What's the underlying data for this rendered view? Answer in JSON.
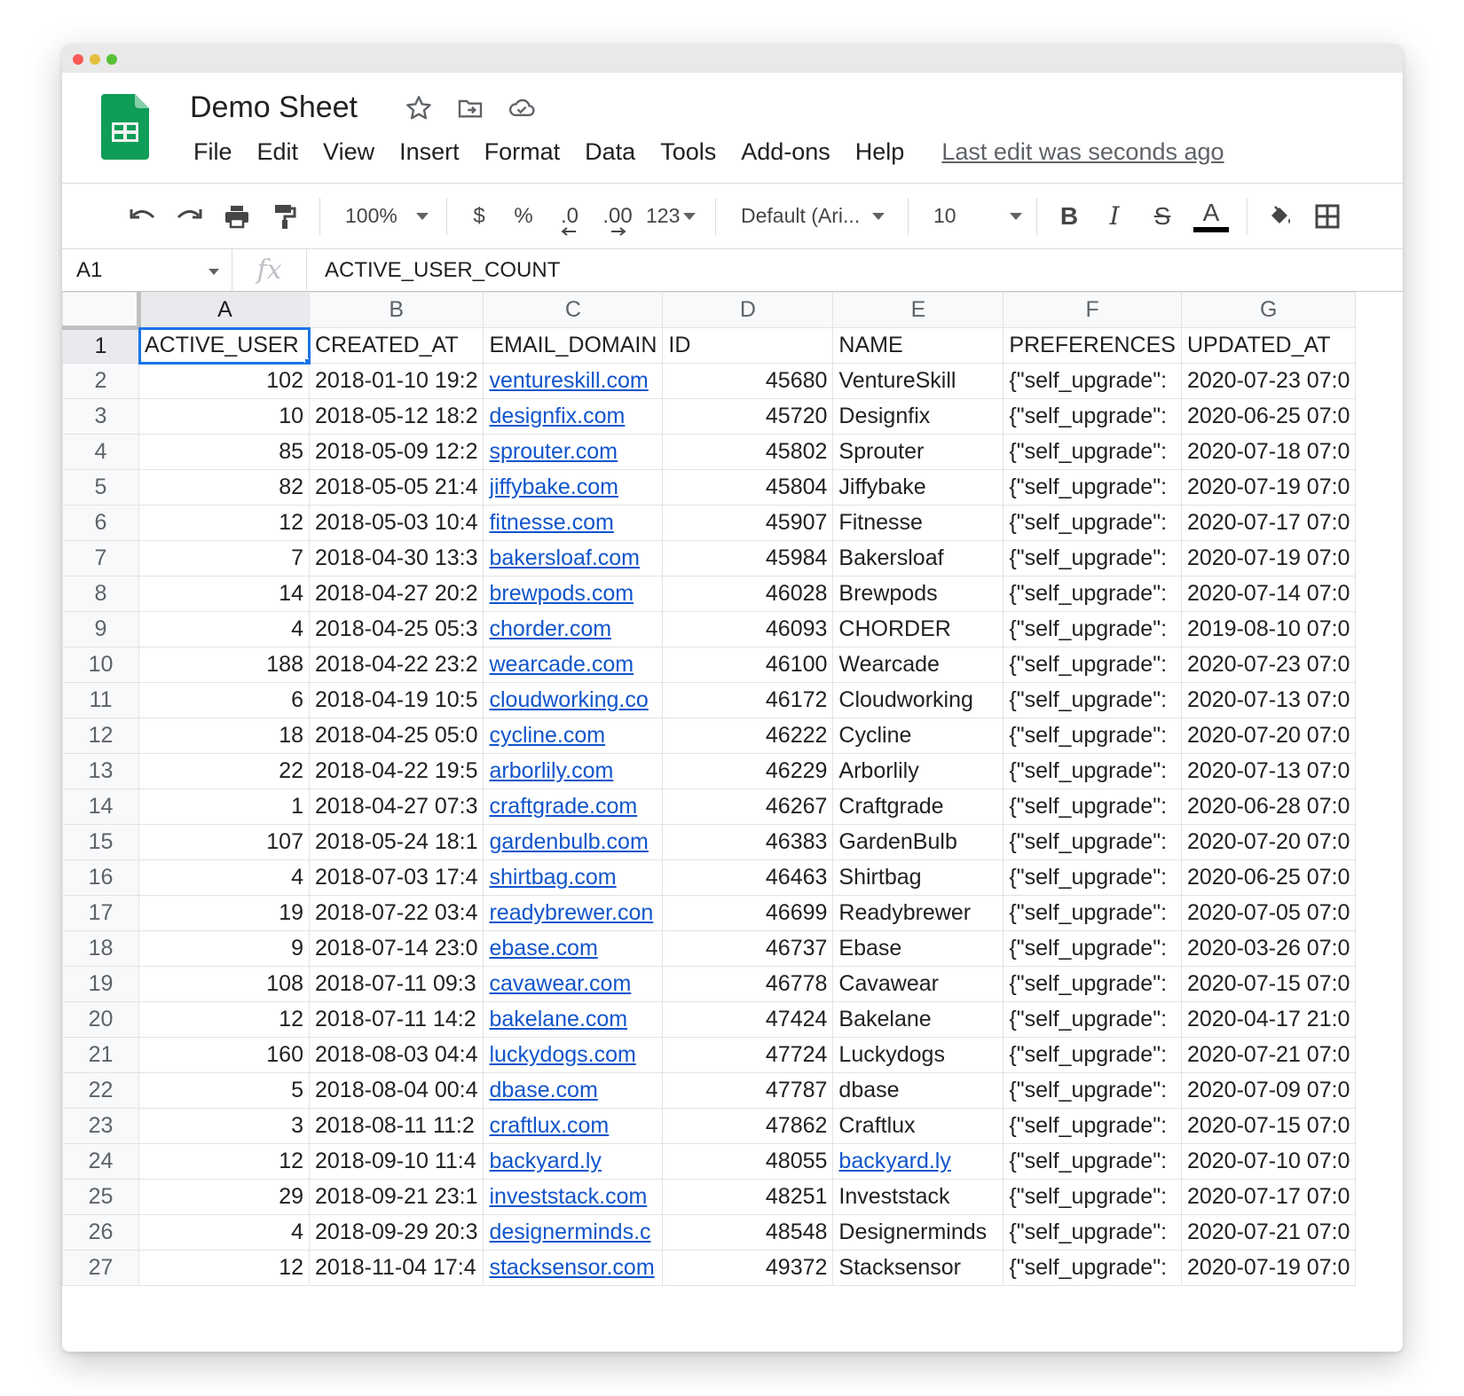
{
  "window": {
    "title": "Demo Sheet"
  },
  "menu": [
    "File",
    "Edit",
    "View",
    "Insert",
    "Format",
    "Data",
    "Tools",
    "Add-ons",
    "Help"
  ],
  "last_edit": "Last edit was seconds ago",
  "toolbar": {
    "zoom": "100%",
    "currency": "$",
    "percent": "%",
    "dec_decrease": ".0",
    "dec_increase": ".00",
    "more_formats": "123",
    "font": "Default (Ari...",
    "font_size": "10",
    "bold": "B",
    "italic": "I",
    "strike": "S",
    "text_color_label": "A"
  },
  "formula_bar": {
    "cell_ref": "A1",
    "fx": "fx",
    "content": "ACTIVE_USER_COUNT"
  },
  "columns": [
    "A",
    "B",
    "C",
    "D",
    "E",
    "F",
    "G"
  ],
  "header_row": [
    "ACTIVE_USER",
    "CREATED_AT",
    "EMAIL_DOMAIN",
    "ID",
    "NAME",
    "PREFERENCES",
    "UPDATED_AT"
  ],
  "rows": [
    {
      "n": "2",
      "a": "102",
      "b": "2018-01-10 19:2",
      "c": "ventureskill.com",
      "d": "45680",
      "e": "VentureSkill",
      "f": "{\"self_upgrade\":",
      "g": "2020-07-23 07:0"
    },
    {
      "n": "3",
      "a": "10",
      "b": "2018-05-12 18:2",
      "c": "designfix.com",
      "d": "45720",
      "e": "Designfix",
      "f": "{\"self_upgrade\":",
      "g": "2020-06-25 07:0"
    },
    {
      "n": "4",
      "a": "85",
      "b": "2018-05-09 12:2",
      "c": "sprouter.com",
      "d": "45802",
      "e": "Sprouter",
      "f": "{\"self_upgrade\":",
      "g": "2020-07-18 07:0"
    },
    {
      "n": "5",
      "a": "82",
      "b": "2018-05-05 21:4",
      "c": "jiffybake.com",
      "d": "45804",
      "e": "Jiffybake",
      "f": "{\"self_upgrade\":",
      "g": "2020-07-19 07:0"
    },
    {
      "n": "6",
      "a": "12",
      "b": "2018-05-03 10:4",
      "c": "fitnesse.com",
      "d": "45907",
      "e": "Fitnesse",
      "f": "{\"self_upgrade\":",
      "g": "2020-07-17 07:0"
    },
    {
      "n": "7",
      "a": "7",
      "b": "2018-04-30 13:3",
      "c": "bakersloaf.com",
      "d": "45984",
      "e": "Bakersloaf",
      "f": "{\"self_upgrade\":",
      "g": "2020-07-19 07:0"
    },
    {
      "n": "8",
      "a": "14",
      "b": "2018-04-27 20:2",
      "c": "brewpods.com",
      "d": "46028",
      "e": "Brewpods",
      "f": "{\"self_upgrade\":",
      "g": "2020-07-14 07:0"
    },
    {
      "n": "9",
      "a": "4",
      "b": "2018-04-25 05:3",
      "c": "chorder.com",
      "d": "46093",
      "e": "CHORDER",
      "f": "{\"self_upgrade\":",
      "g": "2019-08-10 07:0"
    },
    {
      "n": "10",
      "a": "188",
      "b": "2018-04-22 23:2",
      "c": "wearcade.com",
      "d": "46100",
      "e": "Wearcade",
      "f": "{\"self_upgrade\":",
      "g": "2020-07-23 07:0"
    },
    {
      "n": "11",
      "a": "6",
      "b": "2018-04-19 10:5",
      "c": "cloudworking.co",
      "d": "46172",
      "e": "Cloudworking",
      "f": "{\"self_upgrade\":",
      "g": "2020-07-13 07:0"
    },
    {
      "n": "12",
      "a": "18",
      "b": "2018-04-25 05:0",
      "c": "cycline.com",
      "d": "46222",
      "e": "Cycline",
      "f": "{\"self_upgrade\":",
      "g": "2020-07-20 07:0"
    },
    {
      "n": "13",
      "a": "22",
      "b": "2018-04-22 19:5",
      "c": "arborlily.com",
      "d": "46229",
      "e": "Arborlily",
      "f": "{\"self_upgrade\":",
      "g": "2020-07-13 07:0"
    },
    {
      "n": "14",
      "a": "1",
      "b": "2018-04-27 07:3",
      "c": "craftgrade.com",
      "d": "46267",
      "e": "Craftgrade",
      "f": "{\"self_upgrade\":",
      "g": "2020-06-28 07:0"
    },
    {
      "n": "15",
      "a": "107",
      "b": "2018-05-24 18:1",
      "c": "gardenbulb.com",
      "d": "46383",
      "e": "GardenBulb",
      "f": "{\"self_upgrade\":",
      "g": "2020-07-20 07:0"
    },
    {
      "n": "16",
      "a": "4",
      "b": "2018-07-03 17:4",
      "c": "shirtbag.com",
      "d": "46463",
      "e": "Shirtbag",
      "f": "{\"self_upgrade\":",
      "g": "2020-06-25 07:0"
    },
    {
      "n": "17",
      "a": "19",
      "b": "2018-07-22 03:4",
      "c": "readybrewer.con",
      "d": "46699",
      "e": "Readybrewer",
      "f": "{\"self_upgrade\":",
      "g": "2020-07-05 07:0"
    },
    {
      "n": "18",
      "a": "9",
      "b": "2018-07-14 23:0",
      "c": "ebase.com",
      "d": "46737",
      "e": "Ebase",
      "f": "{\"self_upgrade\":",
      "g": "2020-03-26 07:0"
    },
    {
      "n": "19",
      "a": "108",
      "b": "2018-07-11 09:3",
      "c": "cavawear.com",
      "d": "46778",
      "e": "Cavawear",
      "f": "{\"self_upgrade\":",
      "g": "2020-07-15 07:0"
    },
    {
      "n": "20",
      "a": "12",
      "b": "2018-07-11 14:2",
      "c": "bakelane.com",
      "d": "47424",
      "e": "Bakelane",
      "f": "{\"self_upgrade\":",
      "g": "2020-04-17 21:0"
    },
    {
      "n": "21",
      "a": "160",
      "b": "2018-08-03 04:4",
      "c": "luckydogs.com",
      "d": "47724",
      "e": "Luckydogs",
      "f": "{\"self_upgrade\":",
      "g": "2020-07-21 07:0"
    },
    {
      "n": "22",
      "a": "5",
      "b": "2018-08-04 00:4",
      "c": "dbase.com",
      "d": "47787",
      "e": "dbase",
      "f": "{\"self_upgrade\":",
      "g": "2020-07-09 07:0"
    },
    {
      "n": "23",
      "a": "3",
      "b": "2018-08-11 11:2",
      "c": "craftlux.com",
      "d": "47862",
      "e": "Craftlux",
      "f": "{\"self_upgrade\":",
      "g": "2020-07-15 07:0"
    },
    {
      "n": "24",
      "a": "12",
      "b": "2018-09-10 11:4",
      "c": "backyard.ly",
      "d": "48055",
      "e": "backyard.ly",
      "e_link": true,
      "f": "{\"self_upgrade\":",
      "g": "2020-07-10 07:0"
    },
    {
      "n": "25",
      "a": "29",
      "b": "2018-09-21 23:1",
      "c": "investstack.com",
      "d": "48251",
      "e": "Investstack",
      "f": "{\"self_upgrade\":",
      "g": "2020-07-17 07:0"
    },
    {
      "n": "26",
      "a": "4",
      "b": "2018-09-29 20:3",
      "c": "designerminds.c",
      "d": "48548",
      "e": "Designerminds",
      "f": "{\"self_upgrade\":",
      "g": "2020-07-21 07:0"
    },
    {
      "n": "27",
      "a": "12",
      "b": "2018-11-04 17:4",
      "c": "stacksensor.com",
      "d": "49372",
      "e": "Stacksensor",
      "f": "{\"self_upgrade\":",
      "g": "2020-07-19 07:0"
    }
  ],
  "colors": {
    "link": "#1155cc",
    "selection": "#1a73e8",
    "sheets_green": "#0f9d58"
  }
}
